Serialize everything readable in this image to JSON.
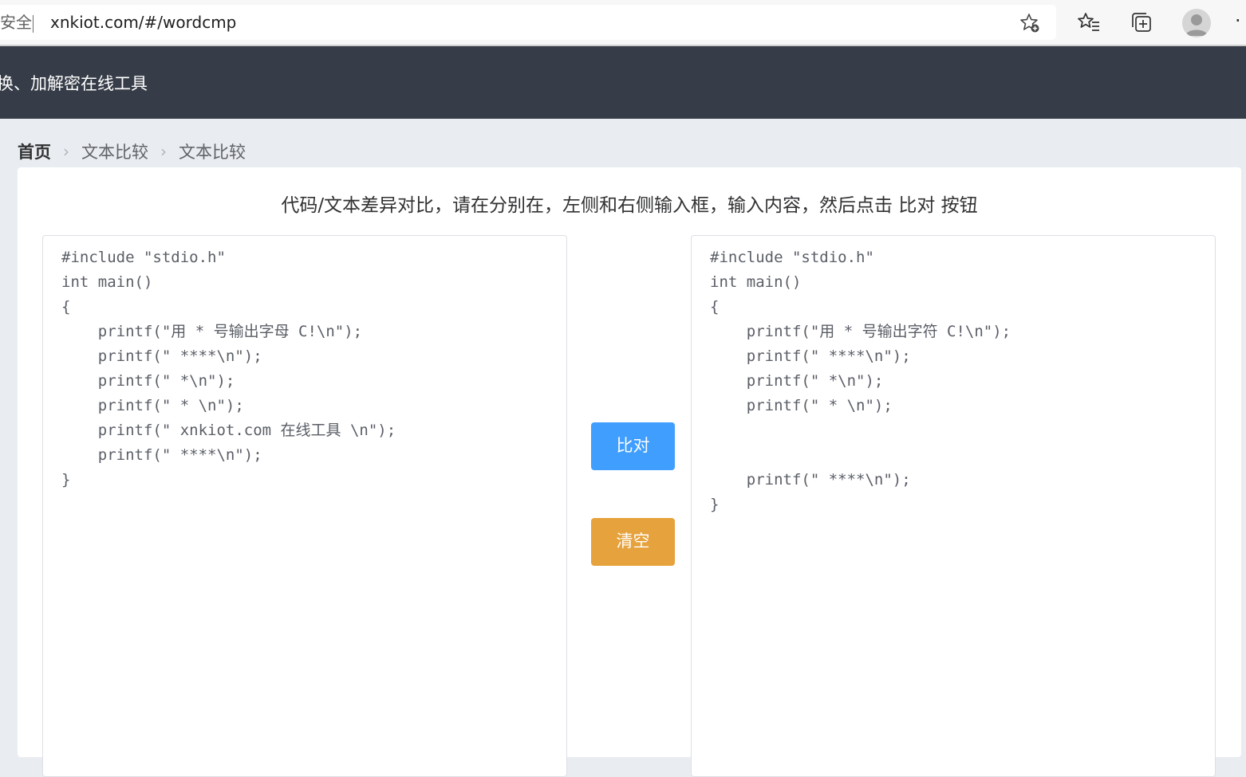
{
  "browser": {
    "security_label": "安全",
    "url": "xnkiot.com/#/wordcmp",
    "more": "·"
  },
  "header": {
    "site_title": "换、加解密在线工具"
  },
  "breadcrumb": {
    "home": "首页",
    "items": [
      "文本比较",
      "文本比较"
    ],
    "separator": "›"
  },
  "main": {
    "instruction": "代码/文本差异对比，请在分别在，左侧和右侧输入框，输入内容，然后点击 比对 按钮",
    "left_lines": [
      "#include \"stdio.h\"",
      "int main()",
      "{",
      "    printf(\"用 * 号输出字母 C!\\n\");",
      "    printf(\" ****\\n\");",
      "    printf(\" *\\n\");",
      "    printf(\" * \\n\");",
      "    printf(\" xnkiot.com 在线工具 \\n\");",
      "    printf(\" ****\\n\");",
      "}"
    ],
    "right_lines": [
      "#include \"stdio.h\"",
      "int main()",
      "{",
      "    printf(\"用 * 号输出字符 C!\\n\");",
      "    printf(\" ****\\n\");",
      "    printf(\" *\\n\");",
      "    printf(\" * \\n\");",
      "",
      "",
      "    printf(\" ****\\n\");",
      "}"
    ],
    "compare_label": "比对",
    "clear_label": "清空"
  },
  "colors": {
    "header_bg": "#373d48",
    "compare_button": "#409eff",
    "clear_button": "#e6a23c"
  }
}
